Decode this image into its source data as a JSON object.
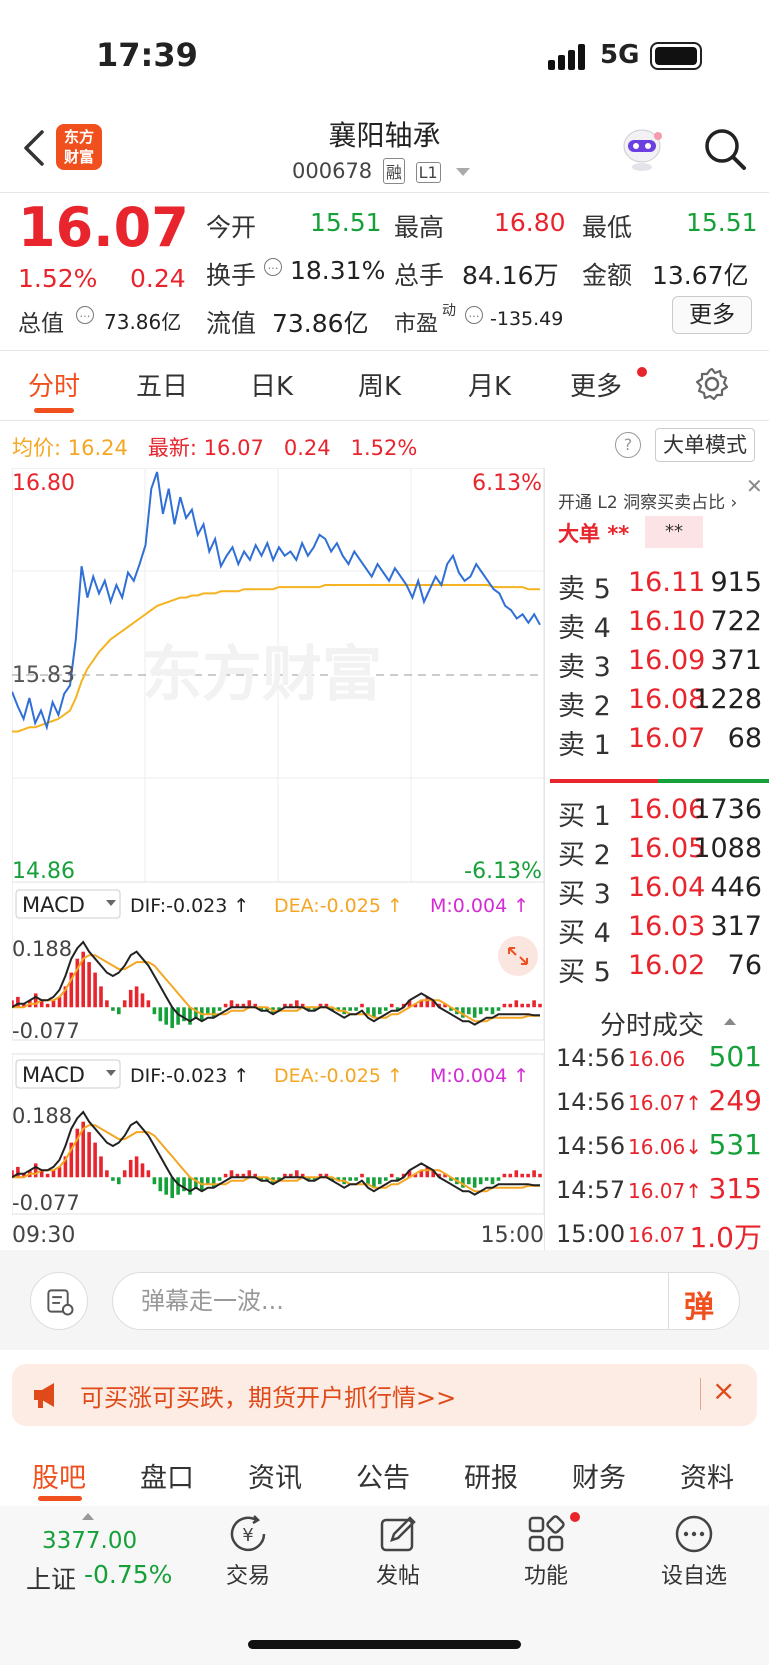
{
  "status": {
    "time": "17:39",
    "network": "5G"
  },
  "header": {
    "logo_line1": "东方",
    "logo_line2": "财富",
    "name": "襄阳轴承",
    "code": "000678",
    "tag_margin": "融",
    "tag_level": "L1"
  },
  "quote": {
    "price": "16.07",
    "change_pct": "1.52%",
    "change": "0.24",
    "open_label": "今开",
    "open": "15.51",
    "high_label": "最高",
    "high": "16.80",
    "low_label": "最低",
    "low": "15.51",
    "turnover_label": "换手",
    "turnover": "18.31%",
    "volume_label": "总手",
    "volume": "84.16万",
    "amount_label": "金额",
    "amount": "13.67亿",
    "mktcap_label": "总值",
    "mktcap": "73.86亿",
    "float_label": "流值",
    "float_cap": "73.86亿",
    "pe_label": "市盈",
    "pe_sup": "动",
    "pe": "-135.49",
    "more_label": "更多"
  },
  "period_tabs": [
    "分时",
    "五日",
    "日K",
    "周K",
    "月K",
    "更多"
  ],
  "avg_row": {
    "avg_label": "均价:",
    "avg": "16.24",
    "latest_label": "最新:",
    "latest": "16.07",
    "change": "0.24",
    "pct": "1.52%",
    "big_order_mode": "大单模式",
    "help": "?"
  },
  "chart_data": {
    "type": "line",
    "title": "",
    "y_top_label": "16.80",
    "y_mid_label": "15.83",
    "y_bottom_label": "14.86",
    "pct_top_label": "6.13%",
    "pct_bottom_label": "-6.13%",
    "watermark": "东方财富",
    "x_start_label": "09:30",
    "x_end_label": "15:00",
    "ylim": [
      14.86,
      16.8
    ],
    "prev_close": 15.83,
    "series": [
      {
        "name": "price",
        "values": [
          15.75,
          15.68,
          15.62,
          15.72,
          15.6,
          15.66,
          15.58,
          15.7,
          15.64,
          15.74,
          15.78,
          16.0,
          16.35,
          16.2,
          16.3,
          16.22,
          16.28,
          16.18,
          16.26,
          16.2,
          16.32,
          16.28,
          16.36,
          16.45,
          16.72,
          16.8,
          16.6,
          16.72,
          16.55,
          16.68,
          16.58,
          16.62,
          16.5,
          16.55,
          16.42,
          16.48,
          16.35,
          16.4,
          16.44,
          16.36,
          16.42,
          16.38,
          16.45,
          16.4,
          16.46,
          16.38,
          16.44,
          16.4,
          16.42,
          16.38,
          16.46,
          16.4,
          16.44,
          16.5,
          16.48,
          16.42,
          16.46,
          16.4,
          16.36,
          16.42,
          16.38,
          16.34,
          16.3,
          16.36,
          16.32,
          16.28,
          16.34,
          16.3,
          16.26,
          16.2,
          16.28,
          16.18,
          16.24,
          16.3,
          16.26,
          16.36,
          16.4,
          16.32,
          16.28,
          16.3,
          16.36,
          16.32,
          16.28,
          16.24,
          16.22,
          16.16,
          16.14,
          16.1,
          16.12,
          16.08,
          16.12,
          16.07
        ]
      },
      {
        "name": "avg",
        "values": [
          15.56,
          15.56,
          15.57,
          15.58,
          15.58,
          15.59,
          15.6,
          15.61,
          15.62,
          15.64,
          15.66,
          15.72,
          15.8,
          15.86,
          15.9,
          15.94,
          15.97,
          16.0,
          16.02,
          16.04,
          16.06,
          16.08,
          16.1,
          16.12,
          16.14,
          16.16,
          16.17,
          16.18,
          16.19,
          16.2,
          16.2,
          16.21,
          16.21,
          16.22,
          16.22,
          16.22,
          16.23,
          16.23,
          16.23,
          16.23,
          16.24,
          16.24,
          16.24,
          16.24,
          16.24,
          16.24,
          16.25,
          16.25,
          16.25,
          16.25,
          16.25,
          16.25,
          16.25,
          16.25,
          16.26,
          16.26,
          16.26,
          16.26,
          16.26,
          16.26,
          16.26,
          16.26,
          16.26,
          16.26,
          16.26,
          16.26,
          16.26,
          16.26,
          16.26,
          16.26,
          16.26,
          16.26,
          16.26,
          16.26,
          16.26,
          16.26,
          16.26,
          16.26,
          16.26,
          16.26,
          16.26,
          16.26,
          16.26,
          16.25,
          16.25,
          16.25,
          16.25,
          16.25,
          16.25,
          16.24,
          16.24,
          16.24
        ]
      }
    ],
    "macd": {
      "label": "MACD",
      "dif": "DIF:-0.023 ↑",
      "dea": "DEA:-0.025 ↑",
      "m": "M:0.004 ↑",
      "y_top": "0.188",
      "y_bottom": "-0.077",
      "ylim": [
        -0.077,
        0.188
      ],
      "bars": [
        0.02,
        0.03,
        0.01,
        0.02,
        0.04,
        0.02,
        0.01,
        0.02,
        0.03,
        0.06,
        0.1,
        0.14,
        0.16,
        0.13,
        0.1,
        0.06,
        0.02,
        -0.01,
        -0.02,
        0.02,
        0.05,
        0.06,
        0.04,
        0.02,
        -0.02,
        -0.04,
        -0.05,
        -0.06,
        -0.05,
        -0.04,
        -0.05,
        -0.03,
        -0.04,
        -0.02,
        -0.03,
        -0.01,
        0.01,
        0.02,
        0.01,
        0.01,
        0.02,
        0.01,
        -0.01,
        -0.01,
        -0.02,
        -0.01,
        0.01,
        0.01,
        0.02,
        0.01,
        -0.01,
        -0.01,
        0.01,
        0.01,
        -0.01,
        -0.01,
        -0.02,
        -0.01,
        -0.01,
        0.01,
        -0.02,
        -0.03,
        -0.02,
        -0.01,
        0.01,
        -0.01,
        0.01,
        0.02,
        0.01,
        0.02,
        0.03,
        0.02,
        0.01,
        0.01,
        -0.01,
        -0.02,
        -0.03,
        -0.02,
        -0.03,
        -0.02,
        -0.01,
        -0.02,
        -0.01,
        0.01,
        0.01,
        0.02,
        0.01,
        0.01,
        0.02,
        0.01
      ],
      "dif_line": [
        0.0,
        0.01,
        0.01,
        0.02,
        0.03,
        0.02,
        0.02,
        0.03,
        0.05,
        0.09,
        0.14,
        0.17,
        0.188,
        0.16,
        0.14,
        0.12,
        0.1,
        0.09,
        0.1,
        0.12,
        0.15,
        0.16,
        0.14,
        0.12,
        0.09,
        0.06,
        0.03,
        0.0,
        -0.02,
        -0.03,
        -0.04,
        -0.03,
        -0.04,
        -0.03,
        -0.03,
        -0.02,
        -0.01,
        0.0,
        0.0,
        0.0,
        0.0,
        0.0,
        -0.01,
        -0.01,
        -0.02,
        -0.01,
        0.0,
        0.0,
        0.0,
        0.0,
        -0.01,
        -0.01,
        0.0,
        0.0,
        -0.01,
        -0.02,
        -0.03,
        -0.02,
        -0.02,
        -0.01,
        -0.03,
        -0.04,
        -0.03,
        -0.02,
        -0.01,
        -0.01,
        0.0,
        0.02,
        0.03,
        0.04,
        0.03,
        0.02,
        0.0,
        -0.01,
        -0.02,
        -0.03,
        -0.04,
        -0.04,
        -0.05,
        -0.04,
        -0.03,
        -0.03,
        -0.02,
        -0.02,
        -0.02,
        -0.02,
        -0.02,
        -0.02,
        -0.023,
        -0.023
      ],
      "dea_line": [
        0.0,
        0.0,
        0.0,
        0.01,
        0.01,
        0.02,
        0.02,
        0.02,
        0.03,
        0.05,
        0.08,
        0.11,
        0.14,
        0.15,
        0.15,
        0.14,
        0.13,
        0.12,
        0.11,
        0.11,
        0.12,
        0.13,
        0.13,
        0.13,
        0.12,
        0.1,
        0.08,
        0.06,
        0.04,
        0.02,
        0.0,
        -0.01,
        -0.02,
        -0.02,
        -0.02,
        -0.02,
        -0.02,
        -0.01,
        -0.01,
        -0.01,
        0.0,
        0.0,
        0.0,
        0.0,
        -0.01,
        -0.01,
        -0.01,
        -0.01,
        -0.01,
        0.0,
        0.0,
        0.0,
        0.0,
        0.0,
        0.0,
        -0.01,
        -0.01,
        -0.02,
        -0.02,
        -0.02,
        -0.02,
        -0.03,
        -0.03,
        -0.03,
        -0.02,
        -0.02,
        -0.01,
        0.0,
        0.01,
        0.02,
        0.02,
        0.02,
        0.02,
        0.01,
        0.0,
        -0.01,
        -0.02,
        -0.03,
        -0.04,
        -0.04,
        -0.04,
        -0.03,
        -0.03,
        -0.03,
        -0.03,
        -0.03,
        -0.03,
        -0.025,
        -0.025,
        -0.025
      ]
    }
  },
  "orderbook": {
    "l2_text": "开通 L2 洞察买卖占比",
    "big_order_label": "大单",
    "big_order_val1": "**",
    "big_order_val2": "**",
    "asks": [
      {
        "label": "卖 5",
        "price": "16.11",
        "vol": "915",
        "color": "#e8242d"
      },
      {
        "label": "卖 4",
        "price": "16.10",
        "vol": "722",
        "color": "#e8242d"
      },
      {
        "label": "卖 3",
        "price": "16.09",
        "vol": "371",
        "color": "#e8242d"
      },
      {
        "label": "卖 2",
        "price": "16.08",
        "vol": "1228",
        "color": "#e8242d"
      },
      {
        "label": "卖 1",
        "price": "16.07",
        "vol": "68",
        "color": "#e8242d"
      }
    ],
    "bids": [
      {
        "label": "买 1",
        "price": "16.06",
        "vol": "1736",
        "color": "#e8242d"
      },
      {
        "label": "买 2",
        "price": "16.05",
        "vol": "1088",
        "color": "#e8242d"
      },
      {
        "label": "买 3",
        "price": "16.04",
        "vol": "446",
        "color": "#e8242d"
      },
      {
        "label": "买 4",
        "price": "16.03",
        "vol": "317",
        "color": "#e8242d"
      },
      {
        "label": "买 5",
        "price": "16.02",
        "vol": "76",
        "color": "#e8242d"
      }
    ],
    "trades_title": "分时成交",
    "trades": [
      {
        "time": "14:56",
        "price": "16.06",
        "vol": "501",
        "price_color": "#e8242d",
        "vol_color": "#16a03a"
      },
      {
        "time": "14:56",
        "price": "16.07↑",
        "vol": "249",
        "price_color": "#e8242d",
        "vol_color": "#e8242d"
      },
      {
        "time": "14:56",
        "price": "16.06↓",
        "vol": "531",
        "price_color": "#e8242d",
        "vol_color": "#16a03a"
      },
      {
        "time": "14:57",
        "price": "16.07↑",
        "vol": "315",
        "price_color": "#e8242d",
        "vol_color": "#e8242d"
      },
      {
        "time": "15:00",
        "price": "16.07",
        "vol": "1.0万",
        "price_color": "#e8242d",
        "vol_color": "#e8242d"
      }
    ]
  },
  "comment": {
    "placeholder": "弹幕走一波...",
    "danmu_icon": "弹"
  },
  "ad": {
    "text": "可买涨可买跌，期货开户抓行情>>",
    "close": "×"
  },
  "bottom_tabs": [
    "股吧",
    "盘口",
    "资讯",
    "公告",
    "研报",
    "财务",
    "资料"
  ],
  "index": {
    "value": "3377.00",
    "name": "上证",
    "pct": "-0.75%"
  },
  "nav": [
    "交易",
    "发帖",
    "功能",
    "设自选"
  ]
}
